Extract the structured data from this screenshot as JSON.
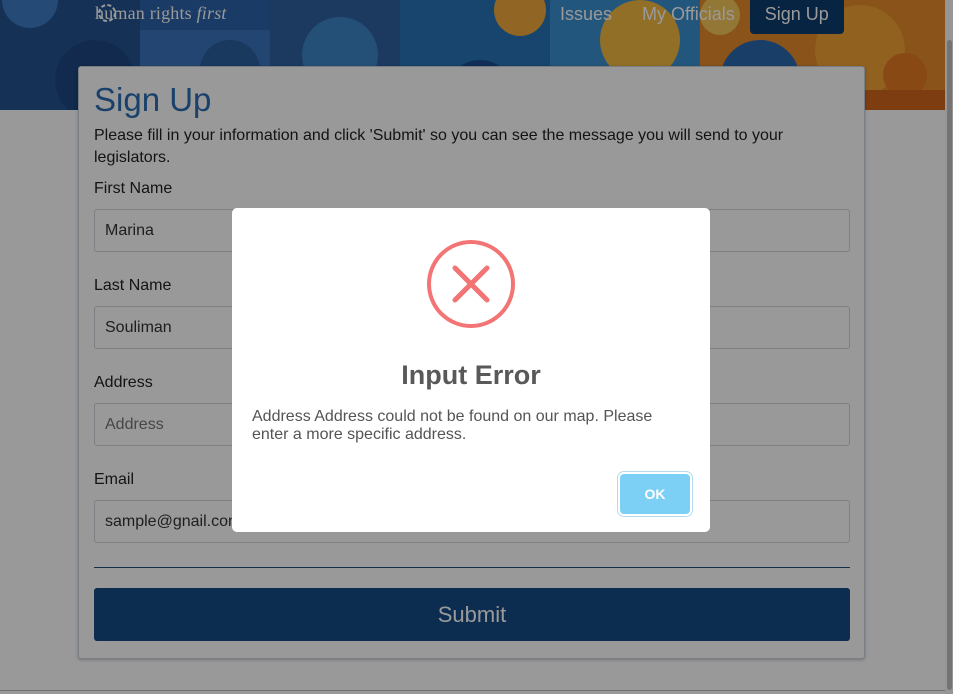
{
  "header": {
    "logo_text_main": "human rights ",
    "logo_text_italic": "first",
    "nav": [
      {
        "label": "Issues"
      },
      {
        "label": "My Officials"
      },
      {
        "label": "Sign Up"
      }
    ]
  },
  "form": {
    "title": "Sign Up",
    "intro": "Please fill in your information and click 'Submit' so you can see the message you will send to your legislators.",
    "fields": [
      {
        "label": "First Name",
        "value": "Marina",
        "placeholder": ""
      },
      {
        "label": "Last Name",
        "value": "Souliman",
        "placeholder": ""
      },
      {
        "label": "Address",
        "value": "",
        "placeholder": "Address"
      },
      {
        "label": "Email",
        "value": "sample@gnail.com",
        "placeholder": ""
      }
    ],
    "submit_label": "Submit"
  },
  "dialog": {
    "icon": "error-x-icon",
    "title": "Input Error",
    "message": "Address Address could not be found on our map. Please enter a more specific address.",
    "ok_label": "OK"
  },
  "colors": {
    "brand_blue": "#2a6db3",
    "submit_blue": "#144b85",
    "error_red": "#f27474",
    "ok_button": "#7ccff5"
  }
}
